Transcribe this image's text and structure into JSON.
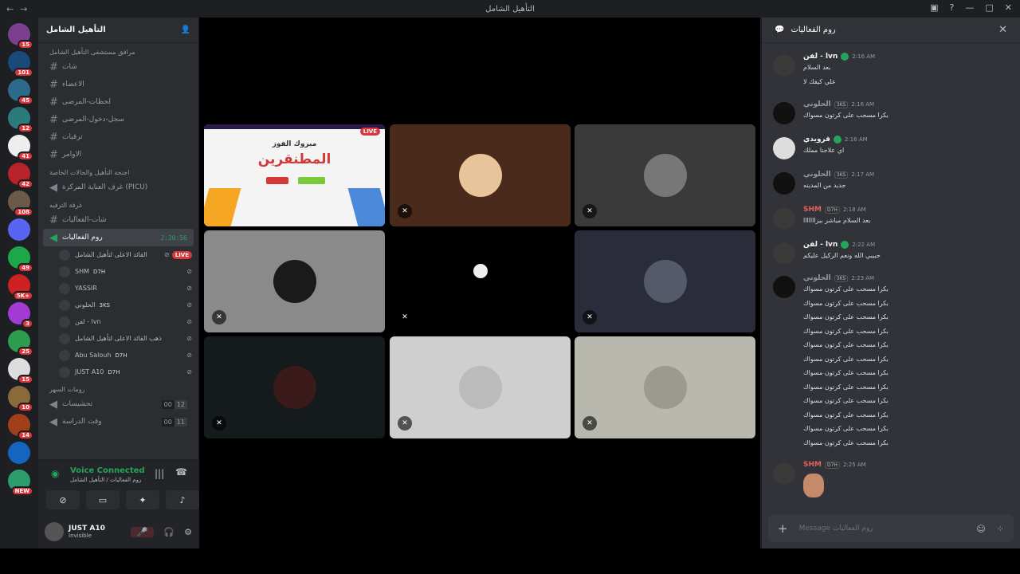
{
  "window": {
    "title": "التأهيل الشامل"
  },
  "guilds": [
    {
      "badge": "15",
      "color": "#7c3f8f"
    },
    {
      "badge": "101",
      "color": "#1a4a7a"
    },
    {
      "badge": "45",
      "color": "#2d6b8a"
    },
    {
      "badge": "12",
      "color": "#2b7b7b"
    },
    {
      "badge": "41",
      "color": "#eeeeee"
    },
    {
      "badge": "42",
      "color": "#b8232b"
    },
    {
      "badge": "108",
      "color": "#6a5a4a"
    },
    {
      "badge": "",
      "color": "#5865f2"
    },
    {
      "badge": "49",
      "color": "#1ea64b"
    },
    {
      "badge": "5K+",
      "color": "#c22"
    },
    {
      "badge": "3",
      "color": "#a23ad3"
    },
    {
      "badge": "25",
      "color": "#2e9c4f"
    },
    {
      "badge": "15",
      "color": "#dddddd"
    },
    {
      "badge": "10",
      "color": "#8a6a3a"
    },
    {
      "badge": "14",
      "color": "#a0401a"
    },
    {
      "badge": "",
      "color": "#1565c0"
    },
    {
      "badge": "NEW",
      "color": "#2b9c6b"
    }
  ],
  "server": {
    "name": "التأهيل الشامل",
    "cat1": "مرافق مستشفى التأهيل الشامل",
    "channels": [
      "شات",
      "الاعضاء",
      "لحظات-المرضى",
      "سجل-دخول-المرضى",
      "ترقيات",
      "الاوامر"
    ],
    "cat2": "اجنحة التأهيل والحالات الخاصة",
    "picu": "غرف العناية المركزة (PICU)",
    "cat3": "غرفة الترفيه",
    "chat_channel": "شات-الفعاليات",
    "voice_channel": "روم الفعاليات",
    "voice_time": "2:20:56",
    "voice_users": [
      {
        "name": "القائد الاعلى لتأهيل الشامل",
        "tag": "",
        "live": "LIVE"
      },
      {
        "name": "SHM",
        "tag": "D7H",
        "live": ""
      },
      {
        "name": "YASSIR",
        "tag": "",
        "live": ""
      },
      {
        "name": "الحلوني",
        "tag": "3KS",
        "live": ""
      },
      {
        "name": "لفن - lvn",
        "tag": "",
        "live": ""
      },
      {
        "name": "ذهب القائد الاعلى لتأهيل الشامل",
        "tag": "",
        "live": ""
      },
      {
        "name": "Abu Salouh",
        "tag": "D7H",
        "live": ""
      },
      {
        "name": "JUST A10",
        "tag": "D7H",
        "live": ""
      }
    ],
    "cat4": "رومات السهر",
    "voice2": [
      {
        "name": "تحشيسات",
        "count_a": "00",
        "count_b": "12"
      },
      {
        "name": "وقت الدراسة",
        "count_a": "00",
        "count_b": "11"
      }
    ]
  },
  "voice_status": {
    "title": "Voice Connected",
    "subtitle": "روم الفعاليات / التأهيل الشامل"
  },
  "user": {
    "name": "JUST A10",
    "status": "Invisible"
  },
  "stream": {
    "live_label": "LIVE",
    "headline": "مبروك الفوز",
    "big_text": "المطنقرين"
  },
  "tiles": [
    {
      "bg": "#000000",
      "avatar": "#ffffff",
      "mute": ""
    },
    {
      "bg": "#4a2a1a",
      "avatar": "#e8c49a",
      "mute": "✕"
    },
    {
      "bg": "#3a3a3a",
      "avatar": "#777777",
      "mute": "✕"
    },
    {
      "bg": "#8a8a8a",
      "avatar": "#1a1a1a",
      "mute": "✕"
    },
    {
      "bg": "#000000",
      "avatar": "#000000",
      "mute": "✕"
    },
    {
      "bg": "#2b2c3a",
      "avatar": "#555a6a",
      "mute": "✕"
    },
    {
      "bg": "#151a1c",
      "avatar": "#3a1a1a",
      "mute": "✕"
    },
    {
      "bg": "#cfcfcf",
      "avatar": "#bbbbbb",
      "mute": "✕"
    },
    {
      "bg": "#b8b8ae",
      "avatar": "#9a9a90",
      "mute": "✕"
    }
  ],
  "chat": {
    "title": "روم الفعاليات",
    "placeholder": "Message روم الفعاليات",
    "messages": [
      {
        "name": "لفن - lvn",
        "name_color": "#f2f3f5",
        "check": true,
        "tag": "",
        "time": "2:16 AM",
        "lines": [
          "بعد السلام",
          "علي كيفك لا"
        ]
      },
      {
        "name": "الحلوني",
        "name_color": "#949ba4",
        "check": false,
        "tag": "3KS",
        "time": "2:16 AM",
        "lines": [
          "بكرا مسحب على كرتون مسواك"
        ]
      },
      {
        "name": "قرويدي",
        "name_color": "#f2f3f5",
        "check": true,
        "tag": "",
        "time": "2:16 AM",
        "lines": [
          "اي علاجنا مملك"
        ]
      },
      {
        "name": "الحلوني",
        "name_color": "#949ba4",
        "check": false,
        "tag": "3KS",
        "time": "2:17 AM",
        "lines": [
          "جديد من المدينه"
        ]
      },
      {
        "name": "SHM",
        "name_color": "#e85d5d",
        "check": false,
        "tag": "D7H",
        "time": "2:18 AM",
        "lines": [
          "بعد السلام مياشر بيزااااااا"
        ]
      },
      {
        "name": "لفن - lvn",
        "name_color": "#f2f3f5",
        "check": true,
        "tag": "",
        "time": "2:22 AM",
        "lines": [
          "حبيبي الله ونعم الركيل عليكم"
        ]
      },
      {
        "name": "الحلوني",
        "name_color": "#949ba4",
        "check": false,
        "tag": "3KS",
        "time": "2:23 AM",
        "lines": [
          "بكرا مسحب على كرتون مسواك",
          "بكرا مسحب على كرتون مسواك",
          "بكرا مسحب على كرتون مسواك",
          "بكرا مسحب على كرتون مسواك",
          "بكرا مسحب على كرتون مسواك",
          "بكرا مسحب على كرتون مسواك",
          "بكرا مسحب على كرتون مسواك",
          "بكرا مسحب على كرتون مسواك",
          "بكرا مسحب على كرتون مسواك",
          "بكرا مسحب على كرتون مسواك",
          "بكرا مسحب على كرتون مسواك",
          "بكرا مسحب على كرتون مسواك"
        ]
      },
      {
        "name": "SHM",
        "name_color": "#e85d5d",
        "check": false,
        "tag": "D7H",
        "time": "2:25 AM",
        "lines": []
      }
    ]
  }
}
